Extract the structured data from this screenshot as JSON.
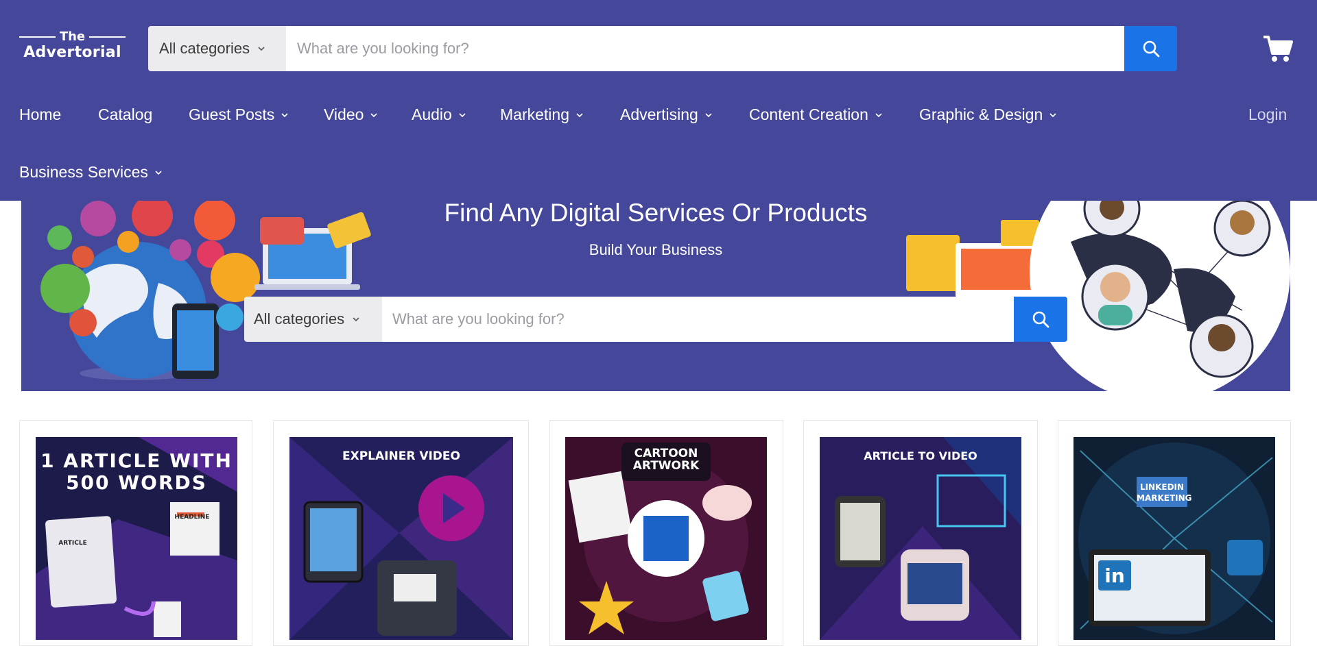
{
  "header": {
    "logo": {
      "line1": "The",
      "line2": "Advertorial"
    },
    "search": {
      "category": "All categories",
      "placeholder": "What are you looking for?"
    },
    "nav": [
      {
        "label": "Home",
        "dropdown": false
      },
      {
        "label": "Catalog",
        "dropdown": false
      },
      {
        "label": "Guest Posts",
        "dropdown": true
      },
      {
        "label": "Video",
        "dropdown": true
      },
      {
        "label": "Audio",
        "dropdown": true
      },
      {
        "label": "Marketing",
        "dropdown": true
      },
      {
        "label": "Advertising",
        "dropdown": true
      },
      {
        "label": "Content Creation",
        "dropdown": true
      },
      {
        "label": "Graphic & Design",
        "dropdown": true
      },
      {
        "label": "Business Services",
        "dropdown": true
      }
    ],
    "login_label": "Login"
  },
  "hero": {
    "title": "Find Any Digital Services Or Products",
    "subtitle": "Build Your Business",
    "search": {
      "category": "All categories",
      "placeholder": "What are you looking for?"
    }
  },
  "products": [
    {
      "thumb_title_line1": "1 ARTICLE WITH",
      "thumb_title_line2": "500 WORDS",
      "thumb_badge1": "HEADLINE",
      "thumb_badge2": "ARTICLE"
    },
    {
      "thumb_title": "EXPLAINER VIDEO"
    },
    {
      "thumb_title_line1": "CARTOON",
      "thumb_title_line2": "ARTWORK"
    },
    {
      "thumb_title": "ARTICLE TO VIDEO"
    },
    {
      "thumb_title_line1": "LINKEDIN",
      "thumb_title_line2": "MARKETING",
      "thumb_badge1": "in"
    }
  ],
  "colors": {
    "brand_purple": "#45479a",
    "search_blue": "#1b73e8",
    "category_bg": "#ececee"
  }
}
